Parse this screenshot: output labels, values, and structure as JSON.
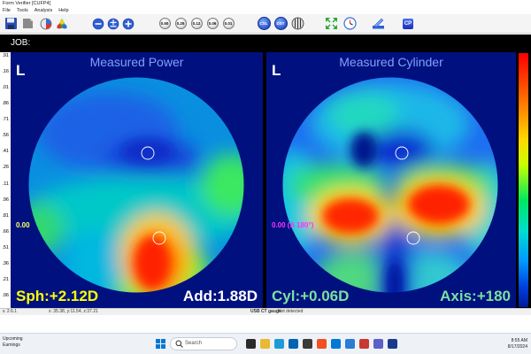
{
  "window": {
    "title": "Form Verifier [CUFP4]",
    "menu": [
      "File",
      "Tools",
      "Analysis",
      "Help"
    ]
  },
  "toolbar": {
    "lens_buttons": [
      "0.50",
      "0.25",
      "0.12",
      "0.06",
      "0.01"
    ],
    "csl_label": "CSL",
    "dst_label": "DST",
    "cp_label": "CP"
  },
  "job": {
    "label": "JOB:"
  },
  "scale": {
    "labels": [
      ".91",
      ".16",
      ".01",
      ".86",
      ".71",
      ".56",
      ".41",
      ".26",
      ".11",
      ".96",
      ".81",
      ".66",
      ".51",
      ".36",
      ".21",
      ".06"
    ]
  },
  "left_panel": {
    "title": "Measured Power",
    "eye": "L",
    "center_value": "0.00",
    "sph": "Sph:+2.12D",
    "add": "Add:1.88D"
  },
  "right_panel": {
    "title": "Measured Cylinder",
    "eye": "L",
    "center_value": "0.00 (A 180°)",
    "cyl": "Cyl:+0.06D",
    "axis": "Axis:+180"
  },
  "colors": {
    "sph_text": "#ffff00",
    "cyl_text": "#7ae0a0",
    "center_value_left": "#ffff66",
    "center_value_right": "#ff33ff",
    "panel_background": "#00117f"
  },
  "statusbar": {
    "version": "v. 2.6.1",
    "coords": "x: 35.38, y:11.54, z:37.21",
    "gauge": "USB CT gauge",
    "gauge_status": "Not detected"
  },
  "taskbar": {
    "weather_title": "Upcoming",
    "weather_sub": "Earnings",
    "search_placeholder": "Search",
    "time": "8:55 AM",
    "date": "8/17/2024"
  }
}
